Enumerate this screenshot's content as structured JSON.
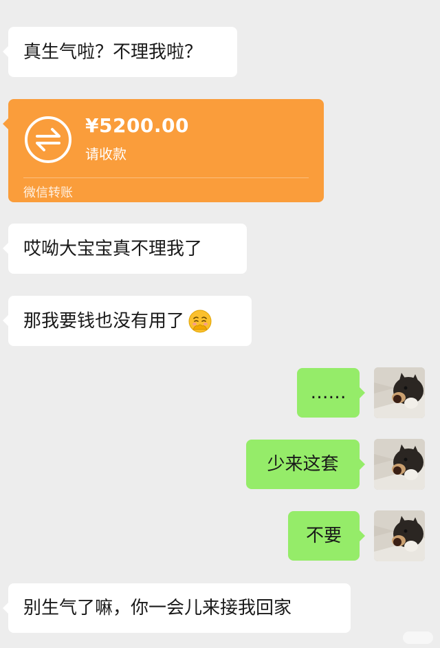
{
  "messages": {
    "m1": {
      "text": "真生气啦？不理我啦？"
    },
    "transfer": {
      "amount": "¥5200.00",
      "status": "请收款",
      "footer": "微信转账",
      "icon": "transfer-arrows-icon",
      "color": "#fa9d3b"
    },
    "m3": {
      "text": "哎呦大宝宝真不理我了"
    },
    "m4": {
      "text": "那我要钱也没有用了",
      "emoji": "pleading-face-icon"
    },
    "m5": {
      "text": "……"
    },
    "m6": {
      "text": "少来这套"
    },
    "m7": {
      "text": "不要"
    },
    "m8": {
      "text": "别生气了嘛，你一会儿来接我回家"
    }
  },
  "colors": {
    "background": "#ededed",
    "incoming_bubble": "#ffffff",
    "outgoing_bubble": "#95ec69",
    "text": "#191919"
  }
}
